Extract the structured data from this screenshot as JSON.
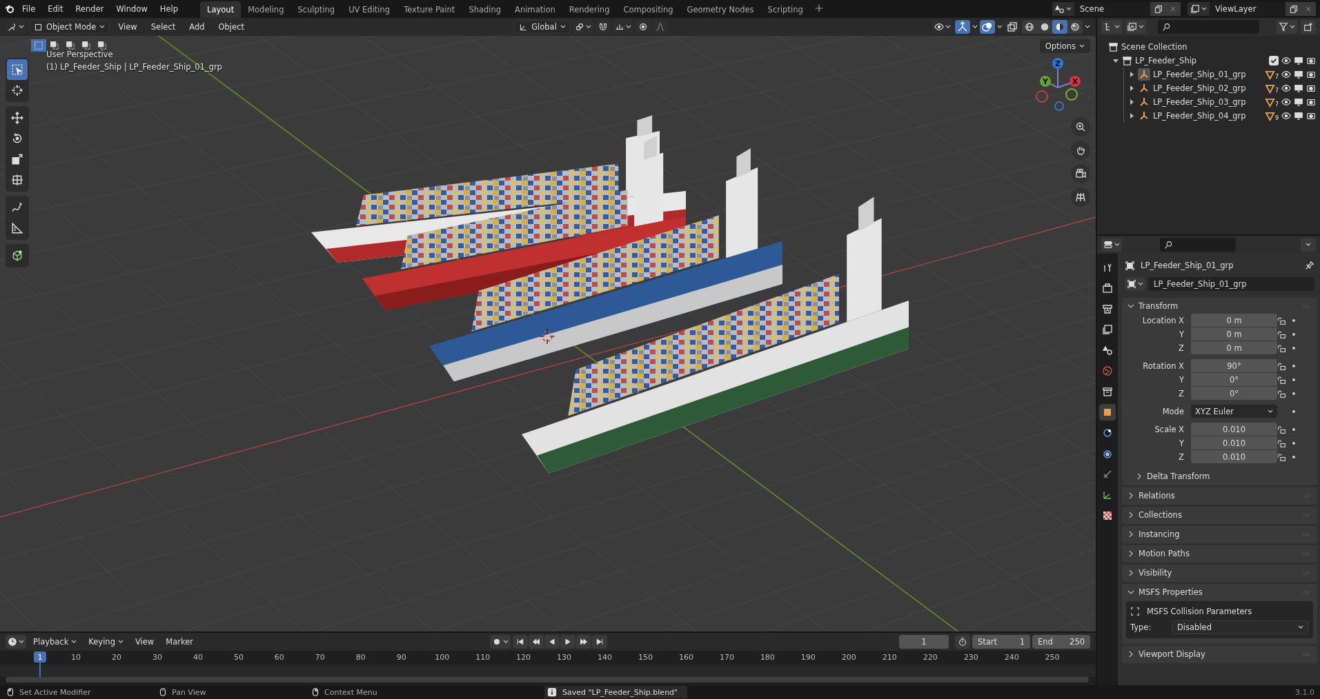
{
  "top_menu": [
    "File",
    "Edit",
    "Render",
    "Window",
    "Help"
  ],
  "workspaces": [
    {
      "label": "Layout",
      "selected": true
    },
    {
      "label": "Modeling",
      "selected": false
    },
    {
      "label": "Sculpting",
      "selected": false
    },
    {
      "label": "UV Editing",
      "selected": false
    },
    {
      "label": "Texture Paint",
      "selected": false
    },
    {
      "label": "Shading",
      "selected": false
    },
    {
      "label": "Animation",
      "selected": false
    },
    {
      "label": "Rendering",
      "selected": false
    },
    {
      "label": "Compositing",
      "selected": false
    },
    {
      "label": "Geometry Nodes",
      "selected": false
    },
    {
      "label": "Scripting",
      "selected": false
    }
  ],
  "scene": "Scene",
  "view_layer": "ViewLayer",
  "viewport": {
    "mode": "Object Mode",
    "menus": [
      "View",
      "Select",
      "Add",
      "Object"
    ],
    "orientation": "Global",
    "options": "Options",
    "select_modes": [
      {
        "selected": true
      },
      {
        "selected": false
      },
      {
        "selected": false
      },
      {
        "selected": false
      },
      {
        "selected": false
      }
    ],
    "toggles": [
      {
        "kind": "gizmos",
        "on": true
      },
      {
        "kind": "overlays",
        "on": true
      },
      {
        "kind": "xray",
        "on": false
      }
    ],
    "shading": [
      {
        "kind": "wireframe",
        "selected": false
      },
      {
        "kind": "solid",
        "selected": false
      },
      {
        "kind": "material",
        "selected": true
      },
      {
        "kind": "rendered",
        "selected": false
      }
    ],
    "info": [
      "User Perspective",
      "(1) LP_Feeder_Ship | LP_Feeder_Ship_01_grp"
    ],
    "tools": [
      {
        "kind": "select",
        "selected": true
      },
      {
        "kind": "cursor",
        "selected": false
      },
      {
        "kind": "move",
        "selected": false
      },
      {
        "kind": "rotate",
        "selected": false
      },
      {
        "kind": "scale",
        "selected": false
      },
      {
        "kind": "transform",
        "selected": false
      },
      {
        "kind": "annotate",
        "selected": false
      },
      {
        "kind": "measure",
        "selected": false
      },
      {
        "kind": "add_cube",
        "selected": false
      }
    ],
    "gizmo_axes": [
      "X",
      "Y",
      "Z"
    ]
  },
  "outliner": {
    "root": "Scene Collection",
    "collection": {
      "name": "LP_Feeder_Ship",
      "expanded": true,
      "checked": true,
      "children": [
        {
          "name": "LP_Feeder_Ship_01_grp",
          "count": "7",
          "active": true
        },
        {
          "name": "LP_Feeder_Ship_02_grp",
          "count": "7",
          "active": false
        },
        {
          "name": "LP_Feeder_Ship_03_grp",
          "count": "7",
          "active": false
        },
        {
          "name": "LP_Feeder_Ship_04_grp",
          "count": "9",
          "active": false
        }
      ]
    }
  },
  "properties": {
    "tabs": [
      {
        "kind": "tool",
        "selected": false
      },
      {
        "kind": "render",
        "selected": false
      },
      {
        "kind": "output",
        "selected": false
      },
      {
        "kind": "view_layer",
        "selected": false
      },
      {
        "kind": "scene",
        "selected": false
      },
      {
        "kind": "world",
        "selected": false
      },
      {
        "kind": "collection",
        "selected": false
      },
      {
        "kind": "object",
        "selected": true
      },
      {
        "kind": "modifiers",
        "selected": false
      },
      {
        "kind": "physics",
        "selected": false
      },
      {
        "kind": "constraints",
        "selected": false
      },
      {
        "kind": "data",
        "selected": false
      },
      {
        "kind": "texture",
        "selected": false
      }
    ],
    "object": "LP_Feeder_Ship_01_grp",
    "object_data": "LP_Feeder_Ship_01_grp",
    "panels": [
      {
        "kind": "transform",
        "title": "Transform",
        "expanded": true,
        "location": [
          {
            "label": "Location X",
            "value": "0 m"
          },
          {
            "label": "Y",
            "value": "0 m"
          },
          {
            "label": "Z",
            "value": "0 m"
          }
        ],
        "rotation": [
          {
            "label": "Rotation X",
            "value": "90°"
          },
          {
            "label": "Y",
            "value": "0°"
          },
          {
            "label": "Z",
            "value": "0°"
          }
        ],
        "mode": {
          "label": "Mode",
          "value": "XYZ Euler"
        },
        "scale": [
          {
            "label": "Scale X",
            "value": "0.010"
          },
          {
            "label": "Y",
            "value": "0.010"
          },
          {
            "label": "Z",
            "value": "0.010"
          }
        ],
        "subpanel": {
          "title": "Delta Transform",
          "expanded": false
        }
      },
      {
        "kind": "plain",
        "title": "Relations",
        "expanded": false
      },
      {
        "kind": "plain",
        "title": "Collections",
        "expanded": false
      },
      {
        "kind": "plain",
        "title": "Instancing",
        "expanded": false
      },
      {
        "kind": "plain",
        "title": "Motion Paths",
        "expanded": false
      },
      {
        "kind": "plain",
        "title": "Visibility",
        "expanded": false
      },
      {
        "kind": "msfs",
        "title": "MSFS Properties",
        "expanded": true,
        "box_title": "MSFS Collision Parameters",
        "type_label": "Type:",
        "type_value": "Disabled"
      },
      {
        "kind": "plain",
        "title": "Viewport Display",
        "expanded": false
      }
    ]
  },
  "timeline": {
    "menus": [
      {
        "label": "Playback",
        "dropdown": true
      },
      {
        "label": "Keying",
        "dropdown": true
      },
      {
        "label": "View",
        "dropdown": false
      },
      {
        "label": "Marker",
        "dropdown": false
      }
    ],
    "current_frame": "1",
    "start_label": "Start",
    "start": "1",
    "end_label": "End",
    "end": "250",
    "playhead": "1",
    "ticks": [
      "10",
      "20",
      "30",
      "40",
      "50",
      "60",
      "70",
      "80",
      "90",
      "100",
      "110",
      "120",
      "130",
      "140",
      "150",
      "160",
      "170",
      "180",
      "190",
      "200",
      "210",
      "220",
      "230",
      "240",
      "250"
    ]
  },
  "status_bar": {
    "hints": [
      {
        "kind": "left_mouse",
        "text": "Set Active Modifier"
      },
      {
        "kind": "middle_mouse",
        "text": "Pan View"
      },
      {
        "kind": "right_mouse",
        "text": "Context Menu"
      }
    ],
    "message": "Saved \"LP_Feeder_Ship.blend\"",
    "version": "3.1.0"
  }
}
